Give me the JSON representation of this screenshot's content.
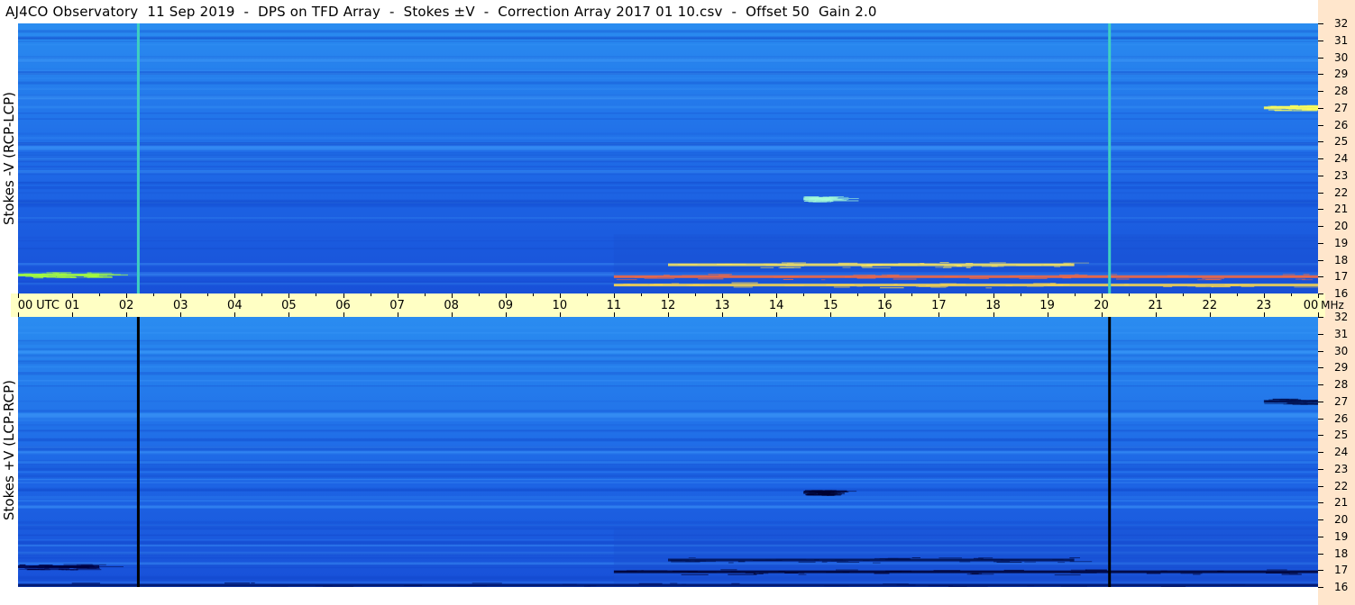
{
  "title": "AJ4CO Observatory  11 Sep 2019  -  DPS on TFD Array  -  Stokes ±V  -  Correction Array 2017 01 10.csv  -  Offset 50  Gain 2.0",
  "chart_data": {
    "type": "heatmap",
    "xlabel": "UTC",
    "freq_unit": "MHz",
    "x_tick_labels": [
      "00",
      "01",
      "02",
      "03",
      "04",
      "05",
      "06",
      "07",
      "08",
      "09",
      "10",
      "11",
      "12",
      "13",
      "14",
      "15",
      "16",
      "17",
      "18",
      "19",
      "20",
      "21",
      "22",
      "23",
      "00"
    ],
    "x_range_hours": [
      0,
      24
    ],
    "y_range_mhz": [
      16,
      32
    ],
    "y_tick_labels": [
      "32",
      "31",
      "30",
      "29",
      "28",
      "27",
      "26",
      "25",
      "24",
      "23",
      "22",
      "21",
      "20",
      "19",
      "18",
      "17",
      "16"
    ],
    "panels": [
      {
        "ylabel": "Stokes -V (RCP-LCP)",
        "base_color": "#1f5fe8",
        "vertical_lines": [
          {
            "hour": 2.22,
            "color": "#3fd0c0"
          },
          {
            "hour": 20.15,
            "color": "#3fd0c0"
          }
        ],
        "bands": [
          {
            "start_hour": 11.0,
            "end_hour": 24.0,
            "mhz": 16.5,
            "color": "#ffd84a"
          },
          {
            "start_hour": 11.0,
            "end_hour": 24.0,
            "mhz": 17.0,
            "color": "#ff6a3a"
          },
          {
            "start_hour": 12.0,
            "end_hour": 19.5,
            "mhz": 17.7,
            "color": "#ffe85a"
          },
          {
            "start_hour": 0.0,
            "end_hour": 1.5,
            "mhz": 17.1,
            "color": "#a8ff3a"
          },
          {
            "start_hour": 23.0,
            "end_hour": 24.0,
            "mhz": 27.0,
            "color": "#ffff5a"
          },
          {
            "start_hour": 14.5,
            "end_hour": 15.0,
            "mhz": 21.6,
            "color": "#a8ffd8"
          }
        ]
      },
      {
        "ylabel": "Stokes +V (LCP-RCP)",
        "base_color": "#1f5fe8",
        "vertical_lines": [
          {
            "hour": 2.22,
            "color": "#000000"
          },
          {
            "hour": 20.15,
            "color": "#000000"
          }
        ],
        "bands": [
          {
            "start_hour": 11.0,
            "end_hour": 24.0,
            "mhz": 16.9,
            "color": "#000030"
          },
          {
            "start_hour": 12.0,
            "end_hour": 19.5,
            "mhz": 17.6,
            "color": "#001050"
          },
          {
            "start_hour": 0.0,
            "end_hour": 24.0,
            "mhz": 16.1,
            "color": "#001060"
          },
          {
            "start_hour": 0.0,
            "end_hour": 1.5,
            "mhz": 17.2,
            "color": "#000040"
          },
          {
            "start_hour": 14.5,
            "end_hour": 15.0,
            "mhz": 21.6,
            "color": "#000030"
          },
          {
            "start_hour": 23.0,
            "end_hour": 24.0,
            "mhz": 27.0,
            "color": "#001050"
          }
        ]
      }
    ]
  }
}
